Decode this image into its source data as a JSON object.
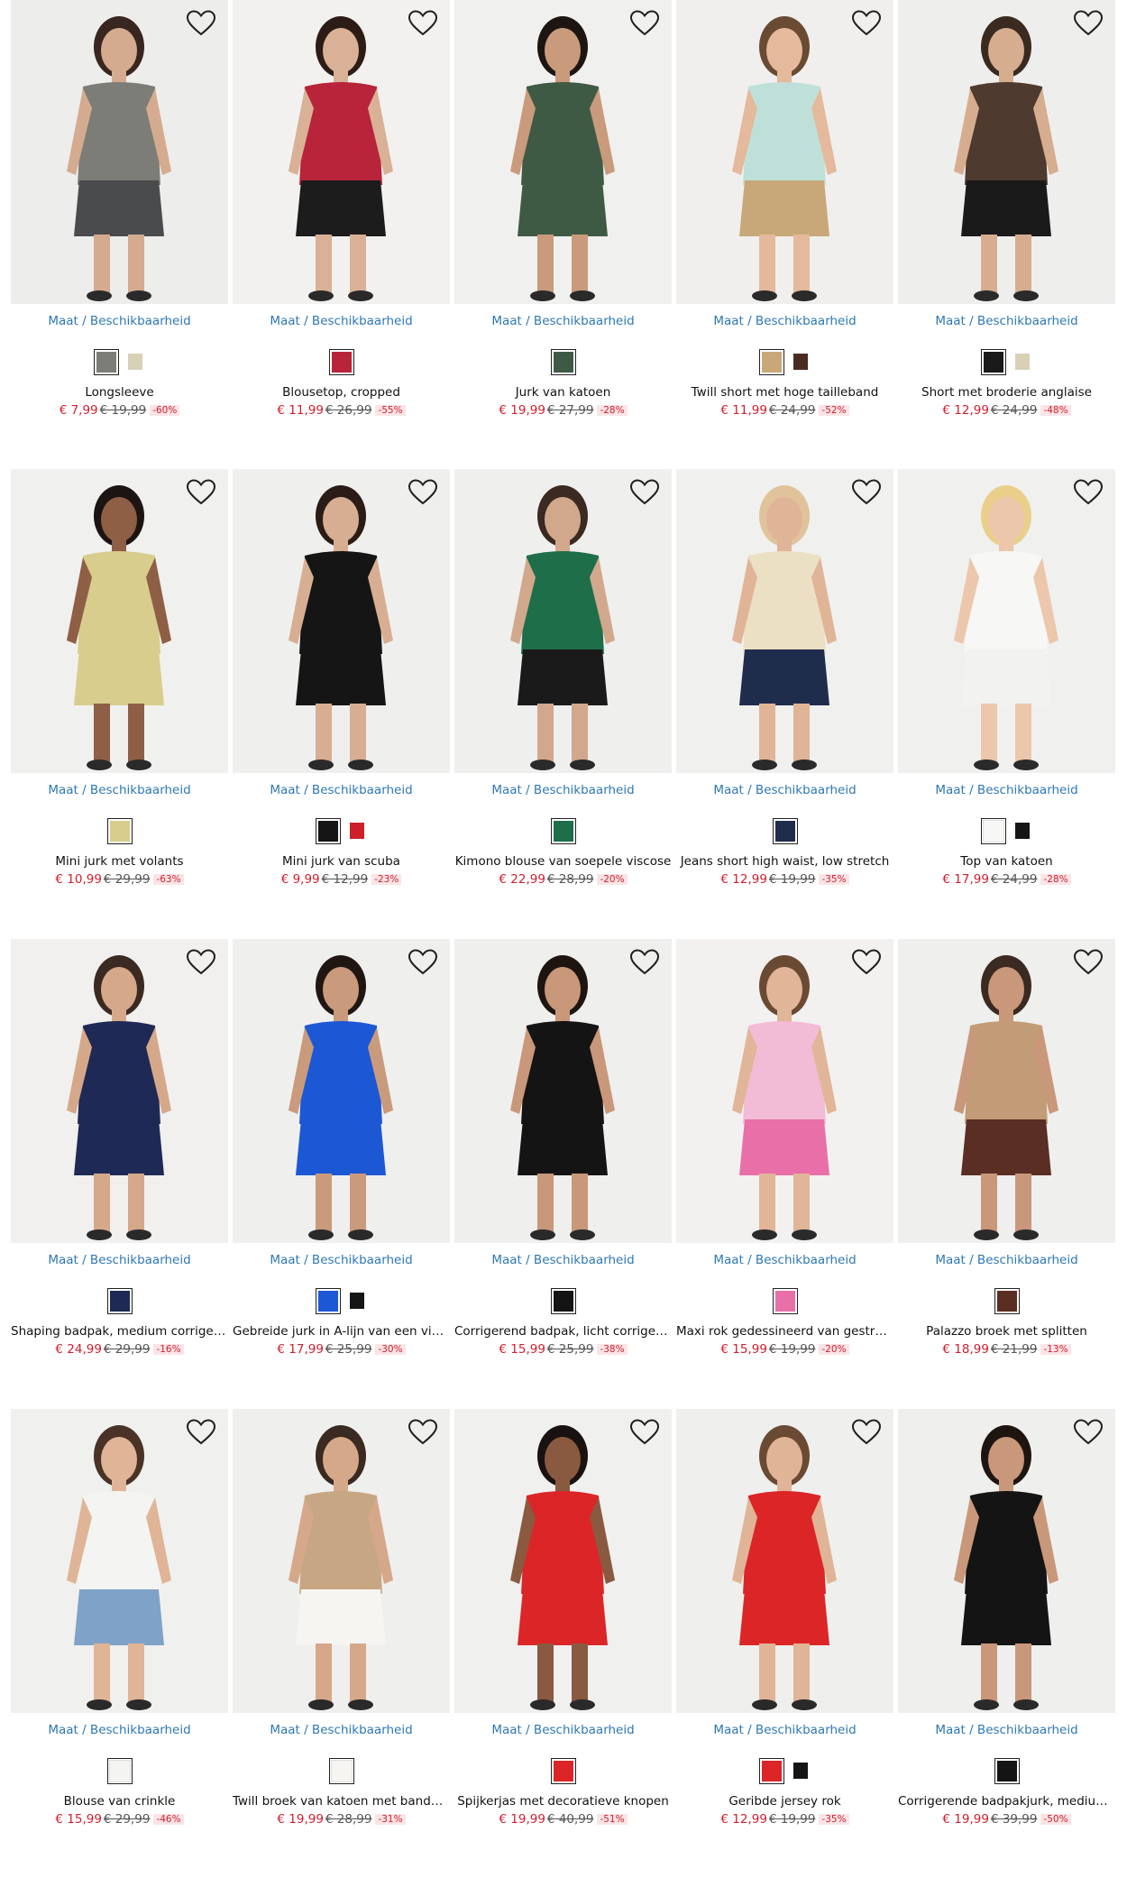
{
  "common": {
    "maat_label": "Maat / Beschikbaarheid",
    "heart_icon": "heart-icon"
  },
  "products": [
    {
      "name": "Longsleeve",
      "price": "€ 7,99",
      "old": "€ 19,99",
      "disc": "-60%",
      "bg": "#ededec",
      "top": "#7d7d78",
      "bottom": "#4a4b4d",
      "skin": "#d5ab8f",
      "hair": "#3a2620",
      "swatches": [
        "#7d7d78",
        "#d9d0b8"
      ]
    },
    {
      "name": "Blousetop, cropped",
      "price": "€ 11,99",
      "old": "€ 26,99",
      "disc": "-55%",
      "bg": "#f2f1ef",
      "top": "#b8243a",
      "bottom": "#1c1c1c",
      "skin": "#d9b196",
      "hair": "#2d1c16",
      "swatches": [
        "#b8243a"
      ]
    },
    {
      "name": "Jurk van katoen",
      "price": "€ 19,99",
      "old": "€ 27,99",
      "disc": "-28%",
      "bg": "#f0f0ef",
      "top": "#3f5a44",
      "bottom": "#3f5a44",
      "skin": "#c99a7b",
      "hair": "#1d1512",
      "swatches": [
        "#3f5a44"
      ]
    },
    {
      "name": "Twill short met hoge tailleband",
      "price": "€ 11,99",
      "old": "€ 24,99",
      "disc": "-52%",
      "bg": "#f0efee",
      "top": "#bfe0d8",
      "bottom": "#c8a878",
      "skin": "#e4b99c",
      "hair": "#6a4a33",
      "swatches": [
        "#c8a878",
        "#4a2b22"
      ]
    },
    {
      "name": "Short met broderie anglaise",
      "price": "€ 12,99",
      "old": "€ 24,99",
      "disc": "-48%",
      "bg": "#eeeeed",
      "top": "#4e3a2e",
      "bottom": "#1a1a1a",
      "skin": "#d7ad90",
      "hair": "#3a2a20",
      "swatches": [
        "#1a1a1a",
        "#d9d0b8"
      ]
    },
    {
      "name": "Mini jurk met volants",
      "price": "€ 10,99",
      "old": "€ 29,99",
      "disc": "-63%",
      "bg": "#f0f0ef",
      "top": "#d8cd8c",
      "bottom": "#d8cd8c",
      "skin": "#8e5e45",
      "hair": "#1b1412",
      "swatches": [
        "#d8cd8c"
      ]
    },
    {
      "name": "Mini jurk van scuba",
      "price": "€ 9,99",
      "old": "€ 12,99",
      "disc": "-23%",
      "bg": "#efefee",
      "top": "#151515",
      "bottom": "#151515",
      "skin": "#d8ae92",
      "hair": "#2a1c16",
      "swatches": [
        "#151515",
        "#cc1f2a"
      ]
    },
    {
      "name": "Kimono blouse van soepele viscose",
      "price": "€ 22,99",
      "old": "€ 28,99",
      "disc": "-20%",
      "bg": "#efefee",
      "top": "#1f6e4a",
      "bottom": "#1a1a1a",
      "skin": "#d2a88c",
      "hair": "#3a2a21",
      "swatches": [
        "#1f6e4a"
      ]
    },
    {
      "name": "Jeans short high waist, low stretch",
      "price": "€ 12,99",
      "old": "€ 19,99",
      "disc": "-35%",
      "bg": "#f0f0ef",
      "top": "#ece0c4",
      "bottom": "#1f2d4d",
      "skin": "#e0b497",
      "hair": "#e0c39a",
      "swatches": [
        "#1f2d4d"
      ]
    },
    {
      "name": "Top van katoen",
      "price": "€ 17,99",
      "old": "€ 24,99",
      "disc": "-28%",
      "bg": "#f0f0ef",
      "top": "#f7f7f5",
      "bottom": "#f2f2f0",
      "skin": "#ecc7ac",
      "hair": "#e9cf8a",
      "swatches": [
        "#f7f7f5",
        "#151515"
      ]
    },
    {
      "name": "Shaping badpak, medium corrigerend",
      "price": "€ 24,99",
      "old": "€ 29,99",
      "disc": "-16%",
      "bg": "#f1f0ef",
      "top": "#1e2a55",
      "bottom": "#1e2a55",
      "skin": "#d6a88a",
      "hair": "#3b2a22",
      "swatches": [
        "#1e2a55"
      ]
    },
    {
      "name": "Gebreide jurk in A-lijn van een viscose-mix",
      "price": "€ 17,99",
      "old": "€ 25,99",
      "disc": "-30%",
      "bg": "#efefee",
      "top": "#1d58d4",
      "bottom": "#1d58d4",
      "skin": "#c99a7c",
      "hair": "#201612",
      "swatches": [
        "#1d58d4",
        "#151515"
      ]
    },
    {
      "name": "Corrigerend badpak, licht corrigerend",
      "price": "€ 15,99",
      "old": "€ 25,99",
      "disc": "-38%",
      "bg": "#efefee",
      "top": "#141414",
      "bottom": "#141414",
      "skin": "#c9977a",
      "hair": "#1e1511",
      "swatches": [
        "#141414"
      ]
    },
    {
      "name": "Maxi rok gedessineerd van gestructureerd materiaal",
      "price": "€ 15,99",
      "old": "€ 19,99",
      "disc": "-20%",
      "bg": "#f2f1f0",
      "top": "#f2bcd6",
      "bottom": "#e86fa7",
      "skin": "#e1b598",
      "hair": "#6a4a33",
      "swatches": [
        "#e86fa7"
      ]
    },
    {
      "name": "Palazzo broek met splitten",
      "price": "€ 18,99",
      "old": "€ 21,99",
      "disc": "-13%",
      "bg": "#efefee",
      "top": "#c29c76",
      "bottom": "#5a2e23",
      "skin": "#c9977a",
      "hair": "#3a2a21",
      "swatches": [
        "#5a2e23"
      ]
    },
    {
      "name": "Blouse van crinkle",
      "price": "€ 15,99",
      "old": "€ 29,99",
      "disc": "-46%",
      "bg": "#f0f0ef",
      "top": "#f4f4f2",
      "bottom": "#7fa3c8",
      "skin": "#e0b497",
      "hair": "#4a3226",
      "swatches": [
        "#f4f4f2"
      ]
    },
    {
      "name": "Twill broek van katoen met bandplooien",
      "price": "€ 19,99",
      "old": "€ 28,99",
      "disc": "-31%",
      "bg": "#efefee",
      "top": "#c7a683",
      "bottom": "#f6f5f2",
      "skin": "#d6a88a",
      "hair": "#3a2a21",
      "swatches": [
        "#f6f5f2"
      ]
    },
    {
      "name": "Spijkerjas met decoratieve knopen",
      "price": "€ 19,99",
      "old": "€ 40,99",
      "disc": "-51%",
      "bg": "#f0f0ef",
      "top": "#dc2527",
      "bottom": "#dc2527",
      "skin": "#8a5a40",
      "hair": "#1a1210",
      "swatches": [
        "#dc2527"
      ]
    },
    {
      "name": "Geribde jersey rok",
      "price": "€ 12,99",
      "old": "€ 19,99",
      "disc": "-35%",
      "bg": "#efefee",
      "top": "#dc2527",
      "bottom": "#dc2527",
      "skin": "#e0b497",
      "hair": "#6a4a33",
      "swatches": [
        "#dc2527",
        "#151515"
      ]
    },
    {
      "name": "Corrigerende badpakjurk, medium corrigerend",
      "price": "€ 19,99",
      "old": "€ 39,99",
      "disc": "-50%",
      "bg": "#efefee",
      "top": "#141414",
      "bottom": "#141414",
      "skin": "#c9977a",
      "hair": "#1e1511",
      "swatches": [
        "#141414"
      ]
    }
  ]
}
